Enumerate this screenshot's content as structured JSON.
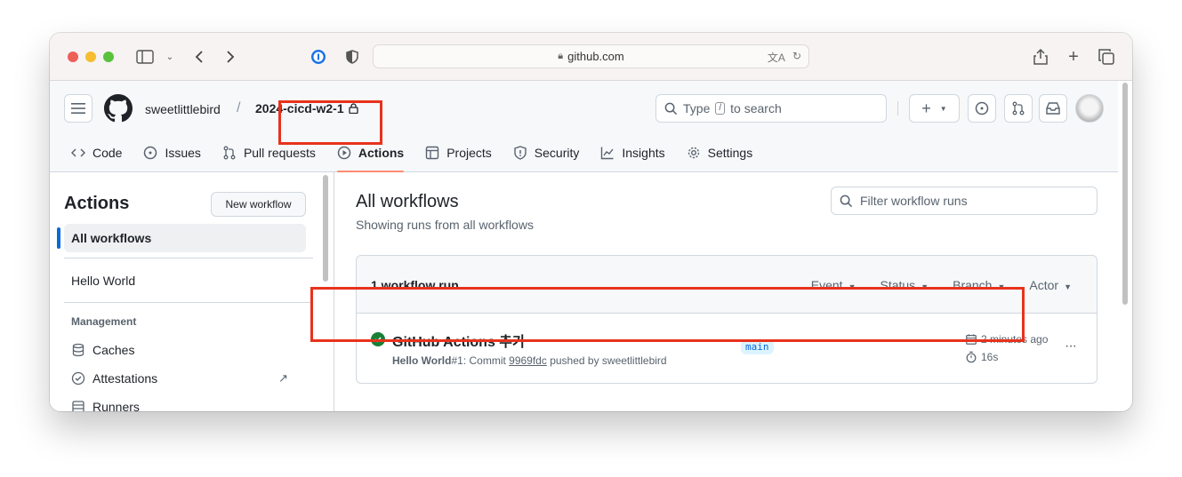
{
  "browser": {
    "url": "github.com"
  },
  "header": {
    "owner": "sweetlittlebird",
    "slash": "/",
    "repo": "2024-cicd-w2-1",
    "search_prefix": "Type",
    "search_key": "/",
    "search_suffix": "to search"
  },
  "tabs": [
    {
      "label": "Code",
      "icon": "code-icon"
    },
    {
      "label": "Issues",
      "icon": "issue-icon"
    },
    {
      "label": "Pull requests",
      "icon": "pull-request-icon"
    },
    {
      "label": "Actions",
      "icon": "play-icon",
      "active": true
    },
    {
      "label": "Projects",
      "icon": "table-icon"
    },
    {
      "label": "Security",
      "icon": "shield-icon"
    },
    {
      "label": "Insights",
      "icon": "graph-icon"
    },
    {
      "label": "Settings",
      "icon": "gear-icon"
    }
  ],
  "sidebar": {
    "title": "Actions",
    "new_workflow": "New workflow",
    "items": [
      {
        "label": "All workflows"
      },
      {
        "label": "Hello World"
      }
    ],
    "management_heading": "Management",
    "management": [
      {
        "label": "Caches",
        "icon": "database-icon"
      },
      {
        "label": "Attestations",
        "icon": "verified-icon"
      },
      {
        "label": "Runners",
        "icon": "server-icon"
      }
    ],
    "external_glyph": "↗"
  },
  "main": {
    "title": "All workflows",
    "subtitle": "Showing runs from all workflows",
    "filter_placeholder": "Filter workflow runs",
    "runs_count": "1 workflow run",
    "filters": [
      "Event",
      "Status",
      "Branch",
      "Actor"
    ],
    "run": {
      "title": "GitHub Actions 추가",
      "workflow": "Hello World",
      "number": "#1",
      "meta_prefix": ": Commit ",
      "sha": "9969fdc",
      "meta_suffix": " pushed by sweetlittlebird",
      "branch": "main",
      "time": "2 minutes ago",
      "duration": "16s",
      "status": "success"
    }
  },
  "colors": {
    "accent": "#0969da",
    "success": "#1a7f37",
    "highlight": "#e8321c",
    "tab_underline": "#fd8c73"
  }
}
